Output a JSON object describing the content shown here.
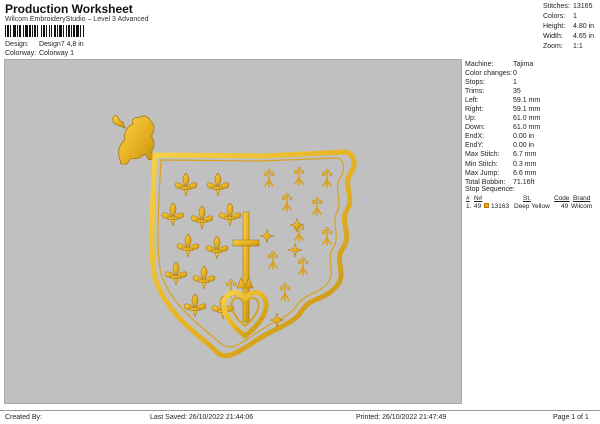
{
  "header": {
    "title": "Production Worksheet",
    "subtitle": "Wilcom EmbroideryStudio – Level 3 Advanced",
    "design_label": "Design:",
    "design_value": "Design7 4,8 in",
    "colorway_label": "Colorway:",
    "colorway_value": "Colorway 1"
  },
  "stats": [
    {
      "label": "Stitches:",
      "value": "13165"
    },
    {
      "label": "Colors:",
      "value": "1"
    },
    {
      "label": "Height:",
      "value": "4.80 in"
    },
    {
      "label": "Width:",
      "value": "4.65 in"
    },
    {
      "label": "Zoom:",
      "value": "1:1"
    }
  ],
  "machine": [
    {
      "label": "Machine:",
      "value": "Tajima"
    },
    {
      "label": "Color changes:",
      "value": "0"
    },
    {
      "label": "Stops:",
      "value": "1"
    },
    {
      "label": "Trims:",
      "value": "35"
    },
    {
      "label": "Left:",
      "value": "59.1 mm"
    },
    {
      "label": "Right:",
      "value": "59.1 mm"
    },
    {
      "label": "Up:",
      "value": "61.0 mm"
    },
    {
      "label": "Down:",
      "value": "61.0 mm"
    },
    {
      "label": "EndX:",
      "value": "0.00 in"
    },
    {
      "label": "EndY:",
      "value": "0.00 in"
    },
    {
      "label": "Max Stitch:",
      "value": "6.7 mm"
    },
    {
      "label": "Min Stitch:",
      "value": "0.3 mm"
    },
    {
      "label": "Max Jump:",
      "value": "6.6 mm"
    },
    {
      "label": "Total Bobbin:",
      "value": "71.16ft"
    }
  ],
  "stop_sequence": {
    "title": "Stop Sequence:",
    "headers": [
      "#",
      "N#",
      "St.",
      "Code",
      "Brand"
    ],
    "rows": [
      {
        "index": "1.",
        "needle": "49",
        "stitches": "13163",
        "name": "Deep Yellow",
        "code": "49",
        "brand": "Wilcom",
        "color": "#f0a418"
      }
    ]
  },
  "footer": {
    "created_by": "Created By:",
    "last_saved": "Last Saved: 26/10/2022 21:44:06",
    "printed": "Printed: 26/10/2022 21:47:49",
    "page": "Page 1 of 1"
  },
  "design_colors": {
    "thread": "#e8b424",
    "thread_dark": "#a9790d",
    "background": "#c0c0c0"
  }
}
